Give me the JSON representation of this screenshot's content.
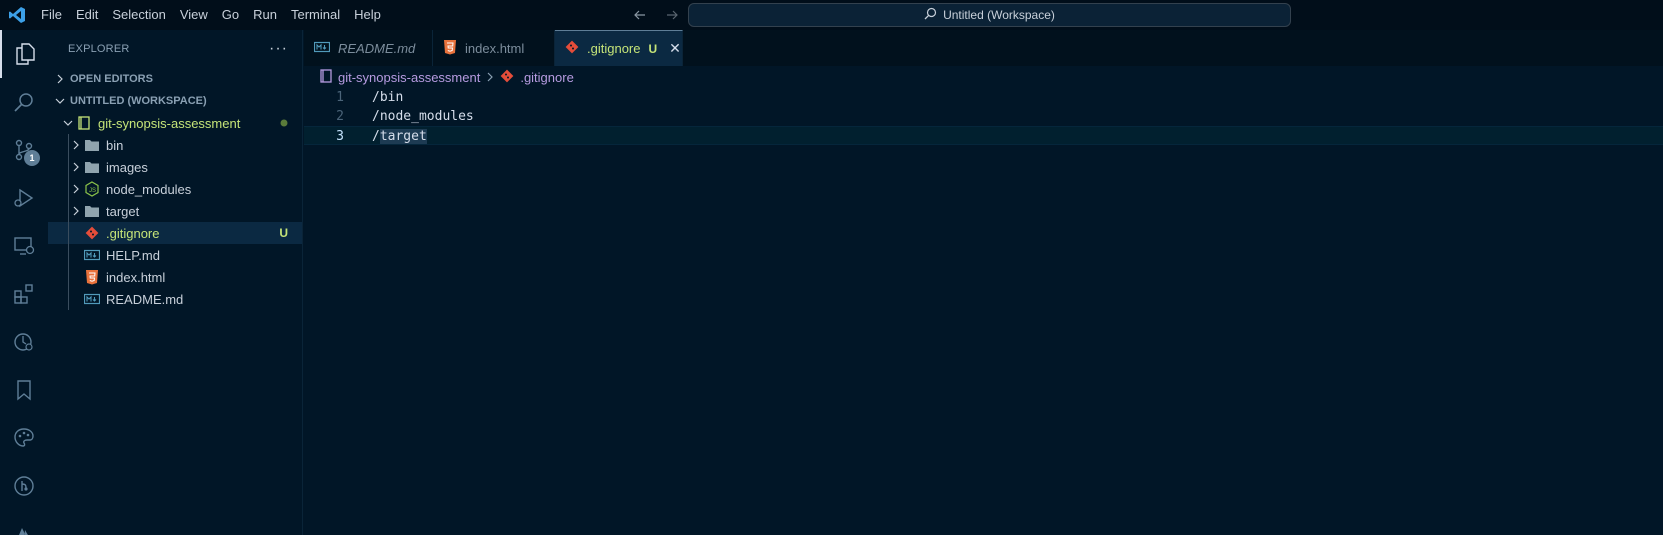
{
  "titlebar": {
    "menu": [
      "File",
      "Edit",
      "Selection",
      "View",
      "Go",
      "Run",
      "Terminal",
      "Help"
    ],
    "search_text": "Untitled (Workspace)"
  },
  "activitybar": {
    "scm_badge": "1"
  },
  "sidebar": {
    "title": "EXPLORER",
    "more": "···",
    "open_editors": "OPEN EDITORS",
    "workspace": "UNTITLED (WORKSPACE)",
    "root_folder": "git-synopsis-assessment",
    "items": [
      {
        "label": "bin",
        "type": "folder"
      },
      {
        "label": "images",
        "type": "folder"
      },
      {
        "label": "node_modules",
        "type": "node-folder"
      },
      {
        "label": "target",
        "type": "folder"
      },
      {
        "label": ".gitignore",
        "type": "git",
        "status": "U"
      },
      {
        "label": "HELP.md",
        "type": "md"
      },
      {
        "label": "index.html",
        "type": "html"
      },
      {
        "label": "README.md",
        "type": "md"
      }
    ]
  },
  "tabs": [
    {
      "label": "README.md"
    },
    {
      "label": "index.html"
    },
    {
      "label": ".gitignore",
      "status": "U",
      "close": "✕"
    }
  ],
  "breadcrumb": {
    "folder": "git-synopsis-assessment",
    "file": ".gitignore"
  },
  "editor": {
    "lines": [
      {
        "num": "1",
        "text": "/bin"
      },
      {
        "num": "2",
        "text": "/node_modules"
      },
      {
        "num": "3",
        "prefix": "/",
        "highlight": "target"
      }
    ]
  },
  "colors": {
    "background": "#011627",
    "accent": "#c5e478",
    "git_icon": "#e44d3a",
    "html_icon": "#e8723c",
    "md_icon": "#519aba"
  }
}
